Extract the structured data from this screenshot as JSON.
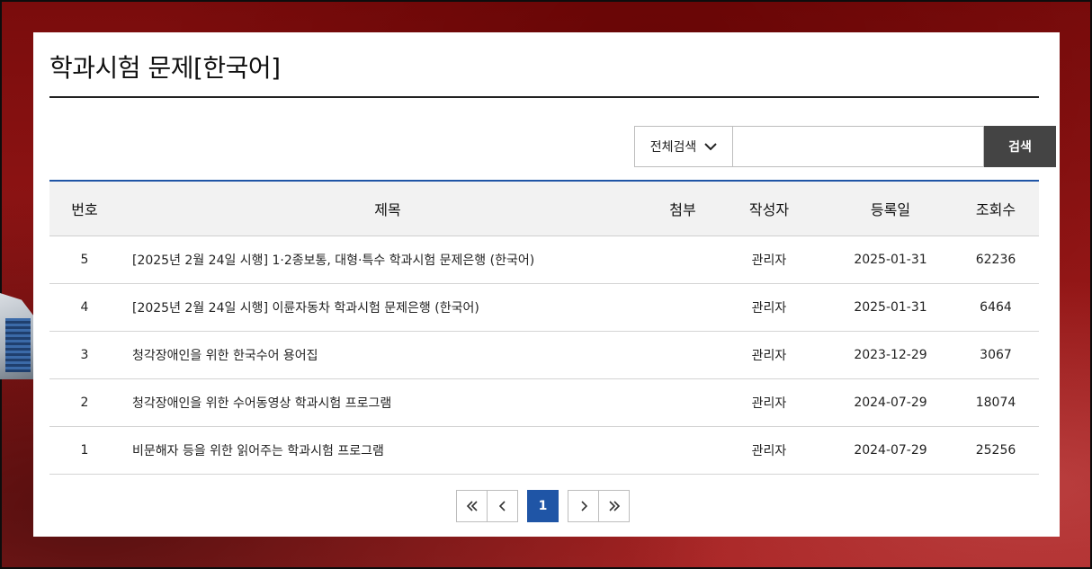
{
  "page": {
    "title": "학과시험 문제[한국어]"
  },
  "search": {
    "select_value": "전체검색",
    "input_value": "",
    "input_placeholder": "",
    "button_label": "검색"
  },
  "table": {
    "headers": {
      "number": "번호",
      "title": "제목",
      "attachment": "첨부",
      "author": "작성자",
      "date": "등록일",
      "views": "조회수"
    },
    "rows": [
      {
        "number": "5",
        "title": "[2025년 2월 24일 시행] 1·2종보통, 대형·특수 학과시험 문제은행 (한국어)",
        "attachment": "",
        "author": "관리자",
        "date": "2025-01-31",
        "views": "62236"
      },
      {
        "number": "4",
        "title": "[2025년 2월 24일 시행] 이륜자동차 학과시험 문제은행 (한국어)",
        "attachment": "",
        "author": "관리자",
        "date": "2025-01-31",
        "views": "6464"
      },
      {
        "number": "3",
        "title": "청각장애인을 위한 한국수어 용어집",
        "attachment": "",
        "author": "관리자",
        "date": "2023-12-29",
        "views": "3067"
      },
      {
        "number": "2",
        "title": "청각장애인을 위한 수어동영상 학과시험 프로그램",
        "attachment": "",
        "author": "관리자",
        "date": "2024-07-29",
        "views": "18074"
      },
      {
        "number": "1",
        "title": "비문해자 등을 위한 읽어주는 학과시험 프로그램",
        "attachment": "",
        "author": "관리자",
        "date": "2024-07-29",
        "views": "25256"
      }
    ]
  },
  "pagination": {
    "current_page": "1",
    "first_icon": "double-chevron-left-icon",
    "prev_icon": "chevron-left-icon",
    "next_icon": "chevron-right-icon",
    "last_icon": "double-chevron-right-icon"
  },
  "colors": {
    "accent": "#1f55a6",
    "search_button": "#444444",
    "header_bg": "#f2f2f2",
    "background": "#8e1414"
  }
}
